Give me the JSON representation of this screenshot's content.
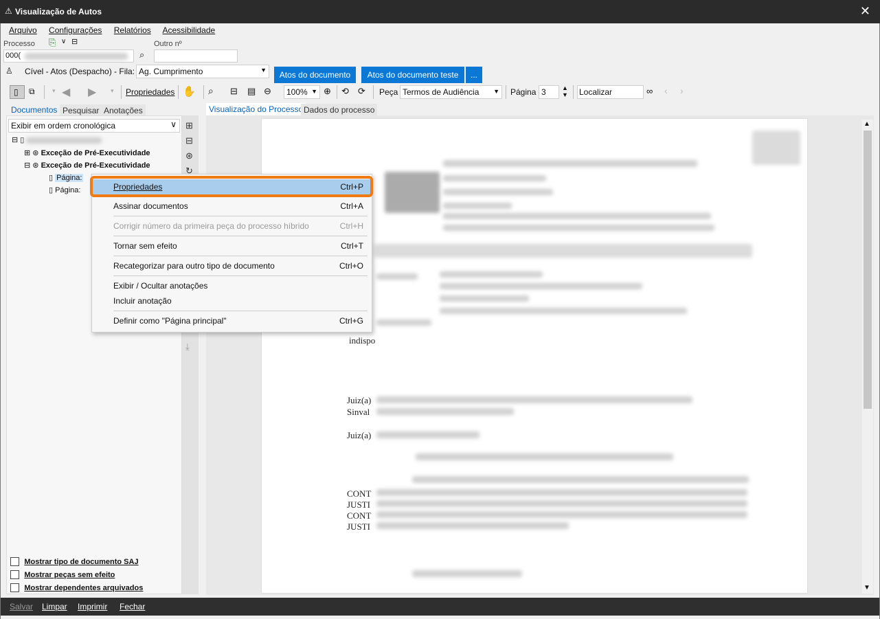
{
  "window": {
    "title": "Visualização de Autos",
    "close": "✕"
  },
  "menu": [
    "Arquivo",
    "Configurações",
    "Relatórios",
    "Acessibilidade"
  ],
  "labels": {
    "processo": "Processo",
    "outro": "Outro nº",
    "processo_value": "000("
  },
  "fila": {
    "caption": "Cível - Atos (Despacho) - Fila:",
    "value": "Ag. Cumprimento"
  },
  "buttons": {
    "atos": "Atos do documento",
    "atos_teste": "Atos do documento teste",
    "more": "..."
  },
  "toolbar": {
    "propriedades": "Propriedades",
    "zoom": "100%",
    "peca_label": "Peça",
    "peca_value": "Termos de Audiência",
    "pagina_label": "Página",
    "pagina_value": "3",
    "localizar": "Localizar"
  },
  "left_tabs": [
    "Documentos",
    "Pesquisar",
    "Anotações"
  ],
  "order_select": "Exibir em ordem cronológica",
  "tree": {
    "item1": "Exceção de Pré-Executividade",
    "item2": "Exceção de Pré-Executividade",
    "page1": "Página:",
    "page2": "Página:"
  },
  "right_tabs": [
    "Visualização do Processo",
    "Dados do processo"
  ],
  "context_menu": [
    {
      "label": "Propriedades",
      "shortcut": "Ctrl+P"
    },
    {
      "label": "Assinar documentos",
      "shortcut": "Ctrl+A"
    },
    {
      "label": "Corrigir número da primeira peça do processo híbrido",
      "shortcut": "Ctrl+H"
    },
    {
      "label": "Tornar sem efeito",
      "shortcut": "Ctrl+T"
    },
    {
      "label": "Recategorizar para outro tipo de documento",
      "shortcut": "Ctrl+O"
    },
    {
      "label": "Exibir / Ocultar anotações",
      "shortcut": ""
    },
    {
      "label": "Incluir anotação",
      "shortcut": ""
    },
    {
      "label": "Definir como \"Página principal\"",
      "shortcut": "Ctrl+G"
    }
  ],
  "page_text": {
    "l1": "indispo",
    "l2": "Juiz(a)",
    "l3": "Sinval",
    "l4": "Juiz(a)",
    "l5": "CONT",
    "l6": "JUSTI",
    "l7": "CONT",
    "l8": "JUSTI"
  },
  "checkboxes": [
    "Mostrar tipo de documento SAJ",
    "Mostrar peças sem efeito",
    "Mostrar dependentes arquivados"
  ],
  "status": [
    "Salvar",
    "Limpar",
    "Imprimir",
    "Fechar"
  ]
}
